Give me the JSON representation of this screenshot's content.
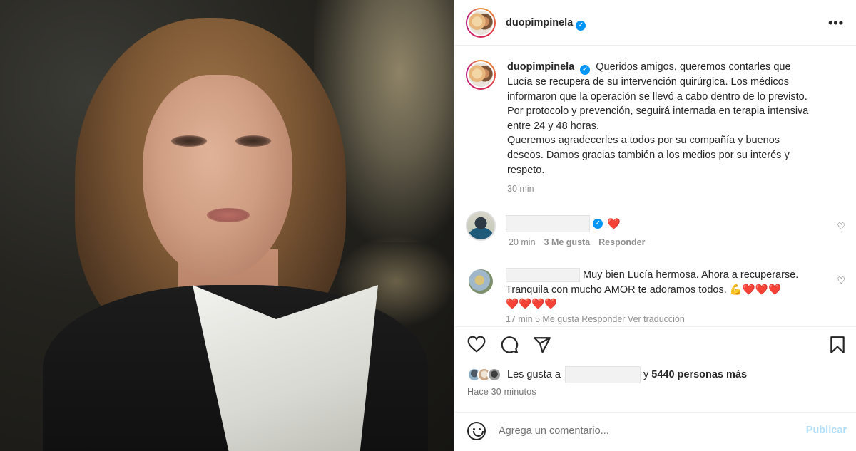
{
  "post": {
    "username": "duopimpinela",
    "more_icon": "more-horizontal-icon",
    "caption": "Queridos amigos, queremos contarles que Lucía se recupera de su intervención quirúrgica. Los médicos informaron que la operación se llevó a cabo dentro de lo previsto. Por protocolo y prevención, seguirá internada en terapia intensiva entre 24 y 48 horas.",
    "caption_2": "Queremos agradecerles a todos por su compañía y buenos deseos. Damos gracias también a los medios por su interés y respeto.",
    "caption_time": "30 min"
  },
  "comments": [
    {
      "text": "❤️",
      "time": "20 min",
      "likes": "3 Me gusta",
      "reply": "Responder"
    },
    {
      "text_line1": "Muy bien Lucía hermosa. Ahora a recuperarse.",
      "text_line2": "Tranquila con mucho AMOR te adoramos todos.",
      "emoji_line2": "💪❤️❤️❤️",
      "emoji_line3": "❤️❤️❤️❤️",
      "partial_meta": "17 min   5 Me gusta   Responder   Ver traducción"
    }
  ],
  "actions": {
    "like_icon": "heart-icon",
    "comment_icon": "comment-icon",
    "share_icon": "send-icon",
    "save_icon": "bookmark-icon"
  },
  "likes": {
    "prefix": "Les gusta a",
    "joiner": "y",
    "count_text": "5440 personas más"
  },
  "post_time": "Hace 30 minutos",
  "composer": {
    "placeholder": "Agrega un comentario...",
    "publish_label": "Publicar"
  },
  "colors": {
    "link_blue": "#0095f6",
    "publish_disabled": "#b2dffc",
    "heart_red": "#e0213a"
  }
}
